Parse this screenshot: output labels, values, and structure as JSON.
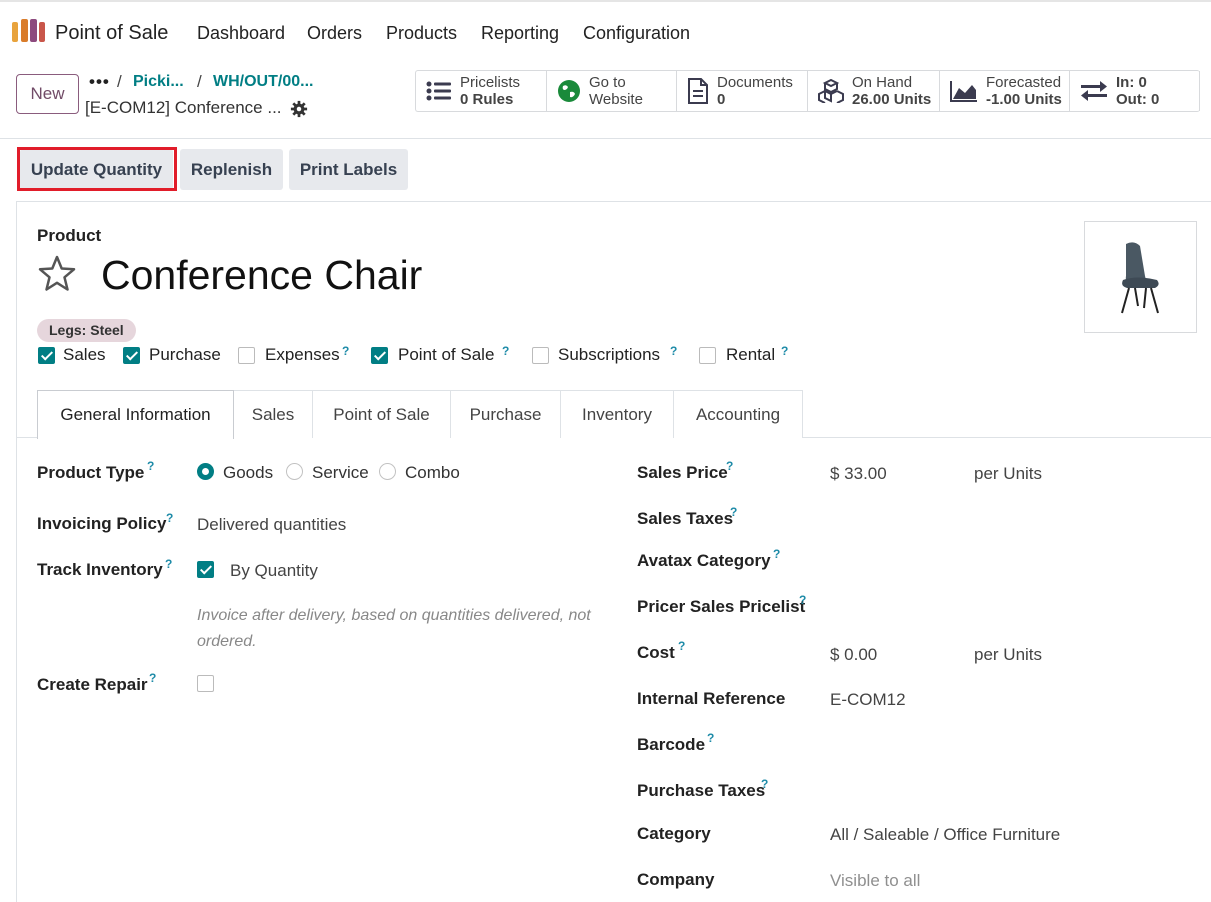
{
  "nav": {
    "app_name": "Point of Sale",
    "items": [
      "Dashboard",
      "Orders",
      "Products",
      "Reporting",
      "Configuration"
    ]
  },
  "control": {
    "new_label": "New",
    "breadcrumb_dots": "•••",
    "breadcrumbs": [
      "Picki...",
      "WH/OUT/00..."
    ],
    "separator": "/",
    "current": "[E-COM12] Conference ..."
  },
  "stats": {
    "pricelists": {
      "line1": "Pricelists",
      "line2": "0 Rules"
    },
    "website": {
      "line1": "Go to",
      "line2": "Website"
    },
    "documents": {
      "line1": "Documents",
      "line2": "0"
    },
    "on_hand": {
      "line1": "On Hand",
      "line2": "26.00 Units"
    },
    "forecasted": {
      "line1": "Forecasted",
      "line2": "-1.00 Units"
    },
    "in_out": {
      "line1": "In: 0",
      "line2": "Out: 0"
    }
  },
  "actions": {
    "update_quantity": "Update Quantity",
    "replenish": "Replenish",
    "print_labels": "Print Labels"
  },
  "product": {
    "label": "Product",
    "name": "Conference Chair",
    "tag": "Legs: Steel",
    "flags": [
      {
        "label": "Sales",
        "checked": true
      },
      {
        "label": "Purchase",
        "checked": true
      },
      {
        "label": "Expenses",
        "checked": false
      },
      {
        "label": "Point of Sale",
        "checked": true
      },
      {
        "label": "Subscriptions",
        "checked": false
      },
      {
        "label": "Rental",
        "checked": false
      }
    ],
    "help_mark": "?"
  },
  "tabs": [
    "General Information",
    "Sales",
    "Point of Sale",
    "Purchase",
    "Inventory",
    "Accounting"
  ],
  "left": {
    "product_type": {
      "label": "Product Type",
      "options": [
        "Goods",
        "Service",
        "Combo"
      ],
      "selected": "Goods"
    },
    "invoicing_policy": {
      "label": "Invoicing Policy",
      "value": "Delivered quantities"
    },
    "track_inventory": {
      "label": "Track Inventory",
      "value": "By Quantity",
      "checked": true
    },
    "hint": "Invoice after delivery, based on quantities delivered, not ordered.",
    "create_repair": {
      "label": "Create Repair",
      "checked": false
    }
  },
  "right": {
    "sales_price": {
      "label": "Sales Price",
      "value": "$ 33.00",
      "unit": "per Units"
    },
    "sales_taxes": {
      "label": "Sales Taxes"
    },
    "avatax": {
      "label": "Avatax Category"
    },
    "pricer": {
      "label": "Pricer Sales Pricelist"
    },
    "cost": {
      "label": "Cost",
      "value": "$ 0.00",
      "unit": "per Units"
    },
    "internal_ref": {
      "label": "Internal Reference",
      "value": "E-COM12"
    },
    "barcode": {
      "label": "Barcode"
    },
    "purchase_taxes": {
      "label": "Purchase Taxes"
    },
    "category": {
      "label": "Category",
      "value": "All / Saleable / Office Furniture"
    },
    "company": {
      "label": "Company",
      "value": "Visible to all"
    }
  },
  "colors": {
    "accent": "#017e84",
    "brand": "#714b67",
    "highlight": "#e11d2a"
  }
}
